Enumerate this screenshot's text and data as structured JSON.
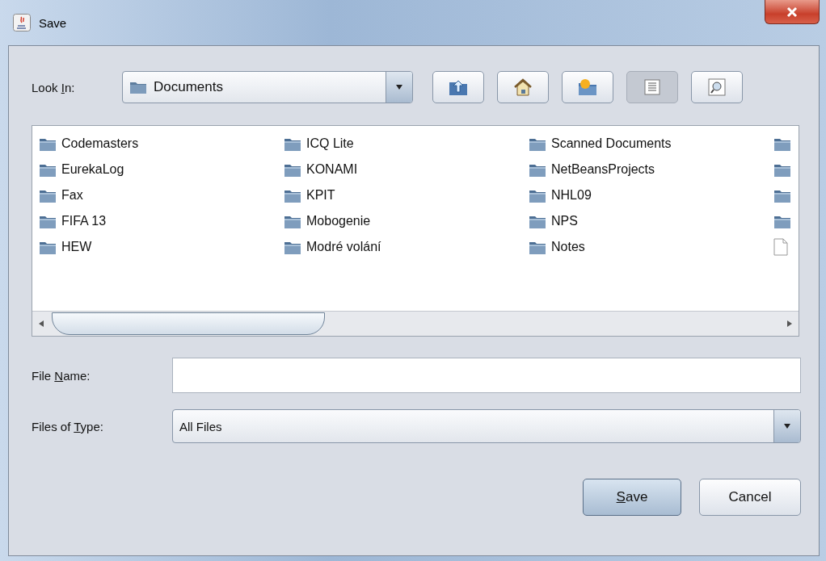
{
  "window": {
    "title": "Save"
  },
  "look_in": {
    "label": {
      "before": "Look ",
      "key": "I",
      "after": "n:"
    },
    "value": "Documents"
  },
  "toolbar": [
    {
      "kind": "up",
      "selected": false
    },
    {
      "kind": "home",
      "selected": false
    },
    {
      "kind": "new-folder",
      "selected": false
    },
    {
      "kind": "list",
      "selected": true
    },
    {
      "kind": "details",
      "selected": false
    }
  ],
  "files": [
    {
      "kind": "folder",
      "name": "Codemasters"
    },
    {
      "kind": "folder",
      "name": "EurekaLog"
    },
    {
      "kind": "folder",
      "name": "Fax"
    },
    {
      "kind": "folder",
      "name": "FIFA 13"
    },
    {
      "kind": "folder",
      "name": "HEW"
    },
    {
      "kind": "folder",
      "name": "ICQ Lite"
    },
    {
      "kind": "folder",
      "name": "KONAMI"
    },
    {
      "kind": "folder",
      "name": "KPIT"
    },
    {
      "kind": "folder",
      "name": "Mobogenie"
    },
    {
      "kind": "folder",
      "name": "Modré volání"
    },
    {
      "kind": "folder",
      "name": "Scanned Documents"
    },
    {
      "kind": "folder",
      "name": "NetBeansProjects"
    },
    {
      "kind": "folder",
      "name": "NHL09"
    },
    {
      "kind": "folder",
      "name": "NPS"
    },
    {
      "kind": "folder",
      "name": "Notes"
    },
    {
      "kind": "folder"
    },
    {
      "kind": "folder"
    },
    {
      "kind": "folder"
    },
    {
      "kind": "folder"
    },
    {
      "kind": "file"
    }
  ],
  "file_name": {
    "label": {
      "before": "File ",
      "key": "N",
      "after": "ame:"
    }
  },
  "file_type": {
    "label": {
      "before": "Files of ",
      "key": "T",
      "after": "ype:"
    },
    "value": "All Files"
  },
  "buttons": [
    {
      "label": {
        "key": "S",
        "after": "ave"
      },
      "kind": "default"
    },
    {
      "label": {
        "before": "Cancel"
      },
      "kind": "normal"
    }
  ]
}
